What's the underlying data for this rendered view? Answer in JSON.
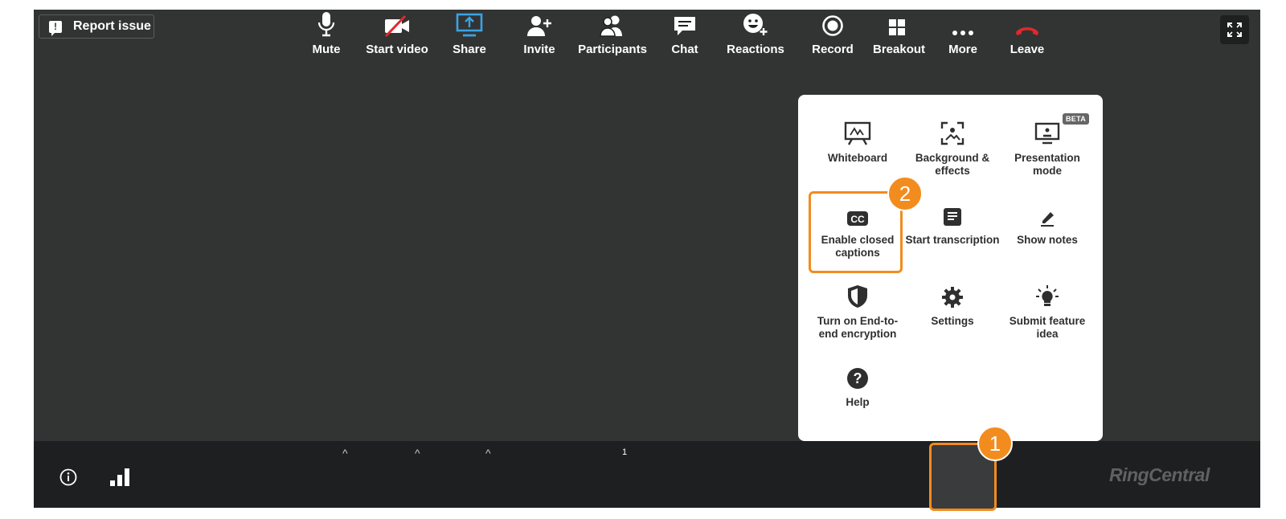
{
  "header": {
    "report_label": "Report issue"
  },
  "more_menu": {
    "items": [
      {
        "label": "Whiteboard",
        "icon": "whiteboard-icon"
      },
      {
        "label": "Background & effects",
        "icon": "background-effects-icon"
      },
      {
        "label": "Presentation mode",
        "icon": "presentation-mode-icon",
        "badge": "BETA"
      },
      {
        "label": "Enable closed captions",
        "icon": "closed-captions-icon"
      },
      {
        "label": "Start transcription",
        "icon": "transcription-icon"
      },
      {
        "label": "Show notes",
        "icon": "notes-icon"
      },
      {
        "label": "Turn on End-to-end encryption",
        "icon": "shield-icon"
      },
      {
        "label": "Settings",
        "icon": "gear-icon"
      },
      {
        "label": "Submit feature idea",
        "icon": "lightbulb-icon"
      },
      {
        "label": "Help",
        "icon": "help-icon"
      }
    ]
  },
  "annotations": {
    "step1": "1",
    "step2": "2",
    "accent": "#f28c1e"
  },
  "toolbar": {
    "mute_label": "Mute",
    "video_label": "Start video",
    "share_label": "Share",
    "invite_label": "Invite",
    "participants_label": "Participants",
    "participants_count": "1",
    "chat_label": "Chat",
    "reactions_label": "Reactions",
    "record_label": "Record",
    "breakout_label": "Breakout",
    "more_label": "More",
    "leave_label": "Leave",
    "share_color": "#3aa3e3",
    "leave_color": "#e0292d"
  },
  "brand": {
    "logo_text": "RingCentral"
  }
}
